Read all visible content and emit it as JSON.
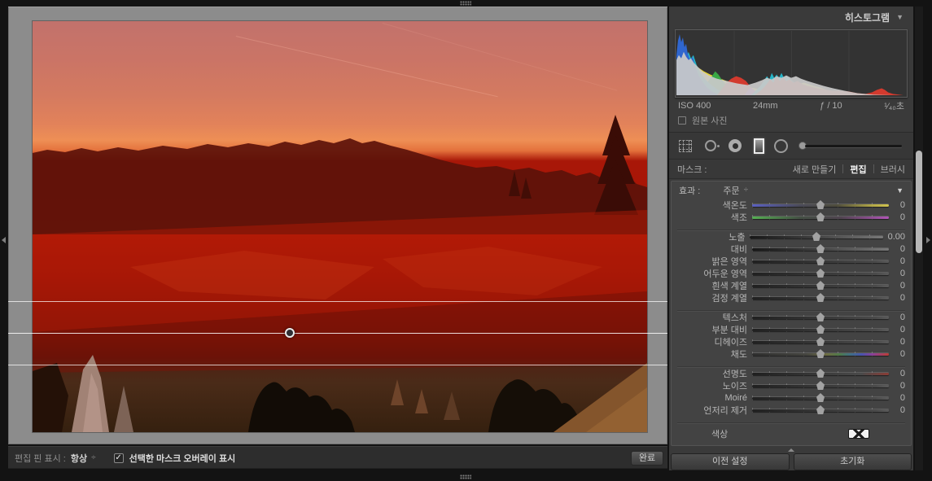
{
  "histogram_panel": {
    "title": "히스토그램",
    "collapse_glyph": "▼",
    "iso": "ISO 400",
    "focal_length": "24mm",
    "aperture": "ƒ / 10",
    "shutter_speed": "¹⁄₄₀초",
    "original_photo_label": "원본 사진"
  },
  "toolstrip": {
    "tools": [
      "crop",
      "spot-removal",
      "red-eye",
      "graduated-filter",
      "radial-filter",
      "brush"
    ],
    "selected_tool": "graduated-filter"
  },
  "mask_bar": {
    "label": "마스크 :",
    "new_button": "새로 만들기",
    "edit_button": "편집",
    "brush_button": "브러시"
  },
  "effect_panel": {
    "label": "효과 :",
    "preset": "주문",
    "popup_glyph": "÷",
    "collapse_glyph": "▼",
    "color_label": "색상",
    "sliders": [
      {
        "label": "색온도",
        "value": "0"
      },
      {
        "label": "색조",
        "value": "0"
      },
      {
        "label": "노출",
        "value": "0.00"
      },
      {
        "label": "대비",
        "value": "0"
      },
      {
        "label": "밝은 영역",
        "value": "0"
      },
      {
        "label": "어두운 영역",
        "value": "0"
      },
      {
        "label": "흰색 계열",
        "value": "0"
      },
      {
        "label": "검정 계열",
        "value": "0"
      },
      {
        "label": "텍스처",
        "value": "0"
      },
      {
        "label": "부분 대비",
        "value": "0"
      },
      {
        "label": "디헤이즈",
        "value": "0"
      },
      {
        "label": "채도",
        "value": "0"
      },
      {
        "label": "선명도",
        "value": "0"
      },
      {
        "label": "노이즈",
        "value": "0"
      },
      {
        "label": "Moiré",
        "value": "0"
      },
      {
        "label": "언저리 제거",
        "value": "0"
      }
    ]
  },
  "panel_footer": {
    "previous_button": "이전 설정",
    "reset_button": "초기화"
  },
  "bottom_toolbar": {
    "pin_label": "편집 핀 표시 :",
    "pin_value": "항상",
    "popup_glyph": "÷",
    "check_glyph": "✓",
    "overlay_checkbox_label": "선택한 마스크 오버레이 표시",
    "done_button": "완료"
  },
  "colors": {
    "mask_overlay_red": "#b41a07",
    "panel_background": "#3a3a3a"
  }
}
